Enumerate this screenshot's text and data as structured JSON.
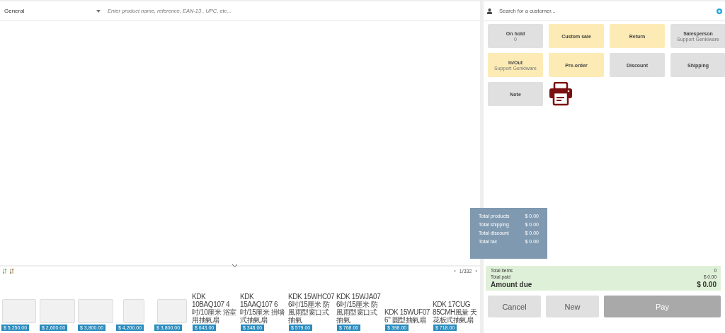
{
  "category_select": {
    "value": "General"
  },
  "product_search": {
    "placeholder": "Enter product name, reference, EAN-13 , UPC, etc..."
  },
  "pagination": {
    "previous": "‹",
    "page": "1/332",
    "next": "›"
  },
  "products": [
    {
      "kind": "photo",
      "price": "$ 5,250.00"
    },
    {
      "kind": "photo",
      "price": "$ 2,600.00"
    },
    {
      "kind": "photo",
      "price": "$ 3,800.00"
    },
    {
      "kind": "photo",
      "price": "$ 4,200.00"
    },
    {
      "kind": "photo",
      "price": "$ 3,800.00"
    },
    {
      "kind": "broken",
      "name": "KDK 10BAQ107 4吋/10厘米 浴室用抽氣扇",
      "price": "$ 643.00"
    },
    {
      "kind": "broken",
      "name": "KDK 15AAQ107 6吋/15厘米 掛墻式抽氣扇",
      "price": "$ 348.00"
    },
    {
      "kind": "broken",
      "name": "KDK 15WHC07 6吋/15厘米 防風雨型窗口式抽氣",
      "price": "$ 579.00"
    },
    {
      "kind": "broken",
      "name": "KDK 15WJA07 6吋/15厘米 防風雨型窗口式抽氣",
      "price": "$ 768.00"
    },
    {
      "kind": "broken",
      "name": "KDK 15WUF07 6\" 圓型抽氣扇",
      "price": "$ 398.00"
    },
    {
      "kind": "broken",
      "name": "KDK 17CUG 85CMH風量 天花板式抽氣扇",
      "price": "$ 718.00"
    }
  ],
  "customer_search": {
    "placeholder": "Search for a customer..."
  },
  "actions": [
    {
      "label": "On hold",
      "sub": "0",
      "color": "#e0e0e0"
    },
    {
      "label": "Custom sale",
      "color": "#fdebb5"
    },
    {
      "label": "Return",
      "color": "#fdebb5"
    },
    {
      "label": "Salesperson",
      "sub": "Support Genkiware",
      "color": "#e0e0e0"
    },
    {
      "label": "In/Out",
      "sub": "Support Genkiware",
      "color": "#fdebb5"
    },
    {
      "label": "Pre-order",
      "color": "#fdebb5"
    },
    {
      "label": "Discount",
      "color": "#e0e0e0"
    },
    {
      "label": "Shipping",
      "color": "#e0e0e0"
    },
    {
      "label": "Note",
      "color": "#e0e0e0"
    }
  ],
  "totals_tooltip": [
    {
      "label": "Total products",
      "value": "$ 0.00"
    },
    {
      "label": "Total shipping",
      "value": "$ 0.00"
    },
    {
      "label": "Total discount",
      "value": "$ 0.00"
    },
    {
      "label": "Total tax",
      "value": "$ 0.00"
    }
  ],
  "summary": {
    "total_items_label": "Total items",
    "total_items": "0",
    "total_paid_label": "Total paid",
    "total_paid": "$ 0.00",
    "amount_due_label": "Amount due",
    "amount_due": "$ 0.00"
  },
  "buttons": [
    {
      "label": "Cancel",
      "disabled": false
    },
    {
      "label": "New",
      "disabled": false
    },
    {
      "label": "Pay",
      "disabled": true
    }
  ]
}
